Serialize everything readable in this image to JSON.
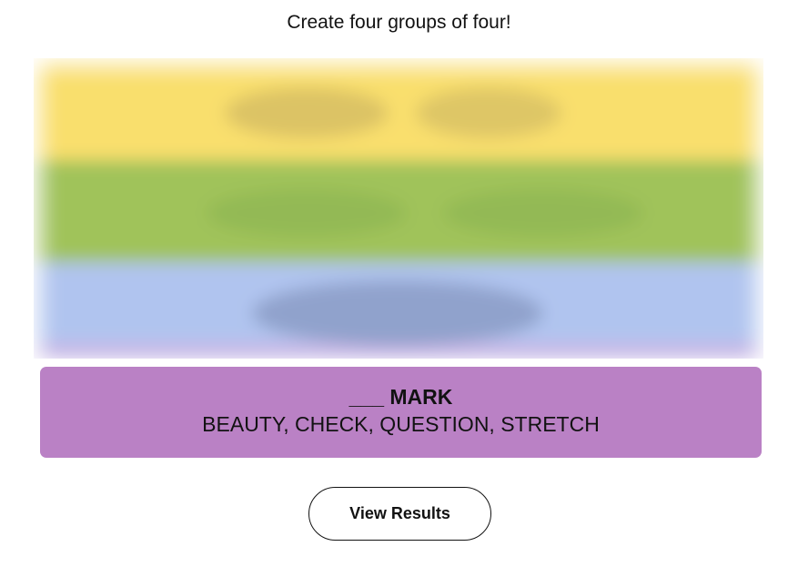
{
  "instructions": "Create four groups of four!",
  "board": {
    "hidden_group_colors": [
      "#f9df6d",
      "#a0c35a",
      "#b0c4ef"
    ]
  },
  "solved_group": {
    "title": "___ MARK",
    "members": "BEAUTY, CHECK, QUESTION, STRETCH",
    "color": "#ba81c5"
  },
  "actions": {
    "view_results_label": "View Results"
  }
}
